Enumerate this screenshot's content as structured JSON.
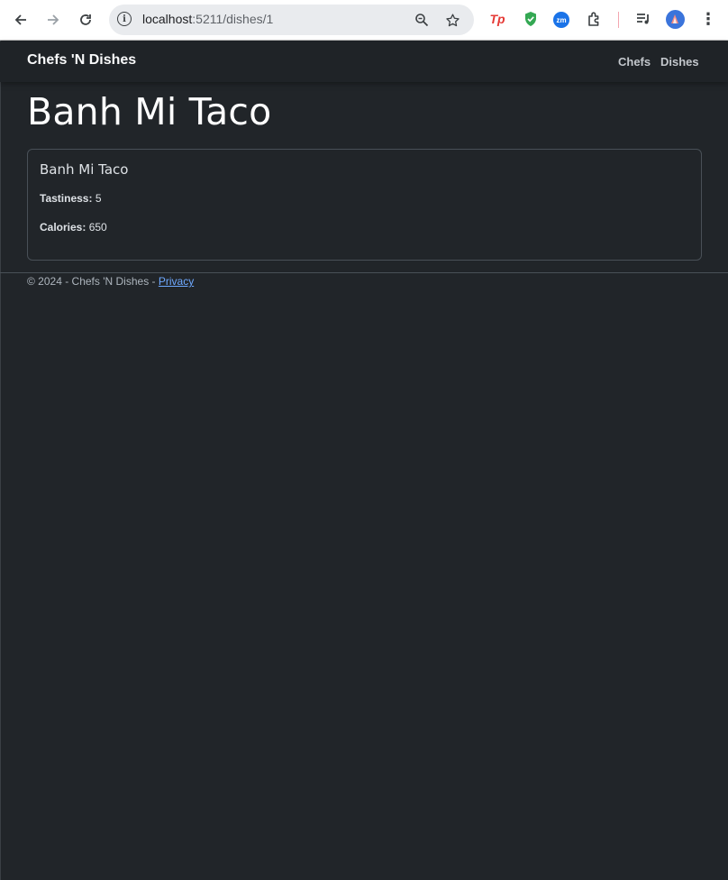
{
  "browser": {
    "url_host": "localhost",
    "url_path": ":5211/dishes/1",
    "icons": {
      "back": "arrow-left-icon",
      "forward": "arrow-right-icon",
      "reload": "reload-icon",
      "site_info": "info-icon",
      "zoom": "zoom-icon",
      "bookmark": "star-icon",
      "extension_tp": "Tp",
      "extension_zm": "zm",
      "extensions": "puzzle-icon",
      "media": "media-control-icon",
      "menu": "kebab-menu-icon"
    }
  },
  "navbar": {
    "brand": "Chefs 'N Dishes",
    "links": [
      "Chefs",
      "Dishes"
    ]
  },
  "page": {
    "title": "Banh Mi Taco"
  },
  "card": {
    "title": "Banh Mi Taco",
    "tastiness_label": "Tastiness:",
    "tastiness_value": "5",
    "calories_label": "Calories:",
    "calories_value": "650"
  },
  "footer": {
    "text": "© 2024 - Chefs 'N Dishes - ",
    "privacy_link": "Privacy"
  },
  "colors": {
    "background": "#212529",
    "link": "#6ea8fe",
    "shield_green": "#34a853",
    "tp_red": "#e53935",
    "zm_blue": "#1a73e8"
  }
}
